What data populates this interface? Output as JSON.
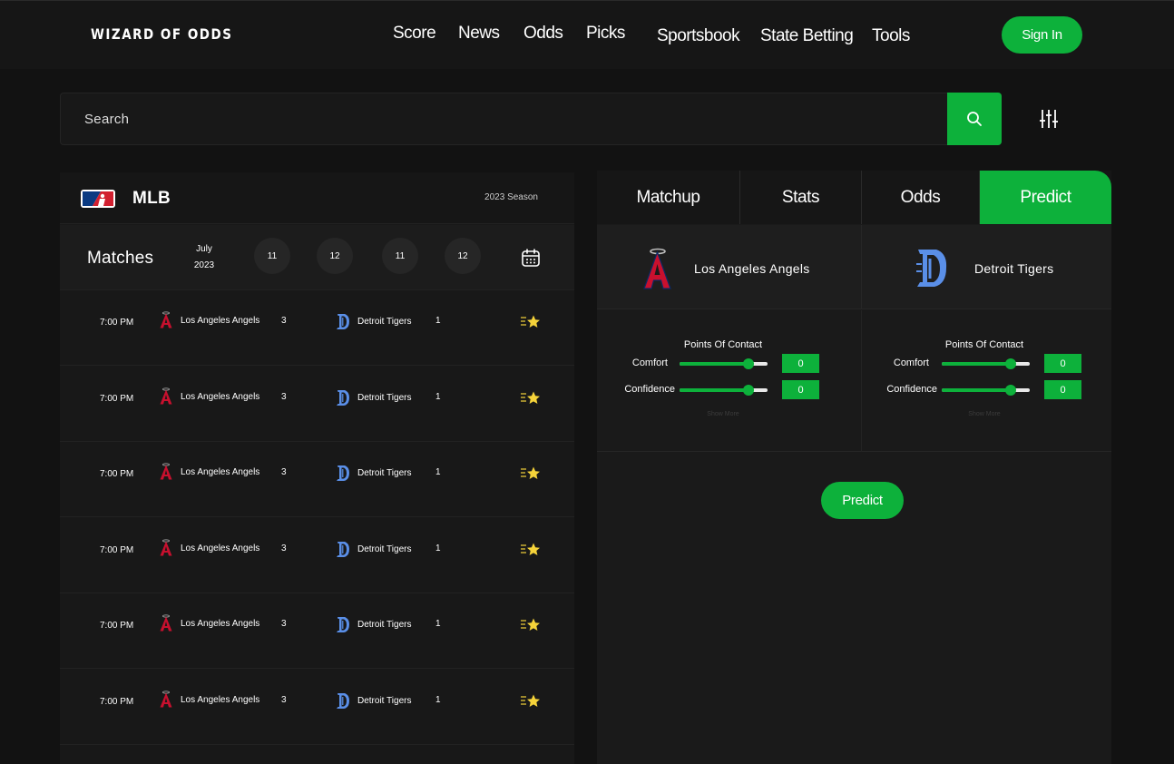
{
  "header": {
    "logo": "WIZARD OF ODDS",
    "nav": [
      "Score",
      "News",
      "Odds",
      "Picks",
      "Sportsbook",
      "State Betting",
      "Tools"
    ],
    "signin_label": "Sign In"
  },
  "search": {
    "placeholder": "Search"
  },
  "league": {
    "name": "MLB",
    "season": "2023 Season"
  },
  "matches": {
    "title": "Matches",
    "month": "July",
    "year": "2023",
    "days": [
      "11",
      "12",
      "11",
      "12"
    ],
    "rows": [
      {
        "time": "7:00 PM",
        "team_a": "Los Angeles Angels",
        "score_a": "3",
        "team_b": "Detroit Tigers",
        "score_b": "1"
      },
      {
        "time": "7:00 PM",
        "team_a": "Los Angeles Angels",
        "score_a": "3",
        "team_b": "Detroit Tigers",
        "score_b": "1"
      },
      {
        "time": "7:00 PM",
        "team_a": "Los Angeles Angels",
        "score_a": "3",
        "team_b": "Detroit Tigers",
        "score_b": "1"
      },
      {
        "time": "7:00 PM",
        "team_a": "Los Angeles Angels",
        "score_a": "3",
        "team_b": "Detroit Tigers",
        "score_b": "1"
      },
      {
        "time": "7:00 PM",
        "team_a": "Los Angeles Angels",
        "score_a": "3",
        "team_b": "Detroit Tigers",
        "score_b": "1"
      },
      {
        "time": "7:00 PM",
        "team_a": "Los Angeles Angels",
        "score_a": "3",
        "team_b": "Detroit Tigers",
        "score_b": "1"
      }
    ]
  },
  "tabs": [
    "Matchup",
    "Stats",
    "Odds",
    "Predict"
  ],
  "active_tab": "Predict",
  "matchup": {
    "team_a": "Los Angeles Angels",
    "team_b": "Detroit Tigers"
  },
  "predict": {
    "section_title": "Points Of Contact",
    "comfort_label": "Comfort",
    "confidence_label": "Confidence",
    "team_a": {
      "comfort": "0",
      "confidence": "0",
      "comfort_level": 0.78,
      "confidence_level": 0.78
    },
    "team_b": {
      "comfort": "0",
      "confidence": "0",
      "comfort_level": 0.78,
      "confidence_level": 0.78
    },
    "show_more": "Show More",
    "predict_label": "Predict"
  },
  "colors": {
    "accent": "#0db13b",
    "background": "#121212",
    "angels_red": "#c8102e",
    "tigers_blue": "#5a8fe8"
  }
}
